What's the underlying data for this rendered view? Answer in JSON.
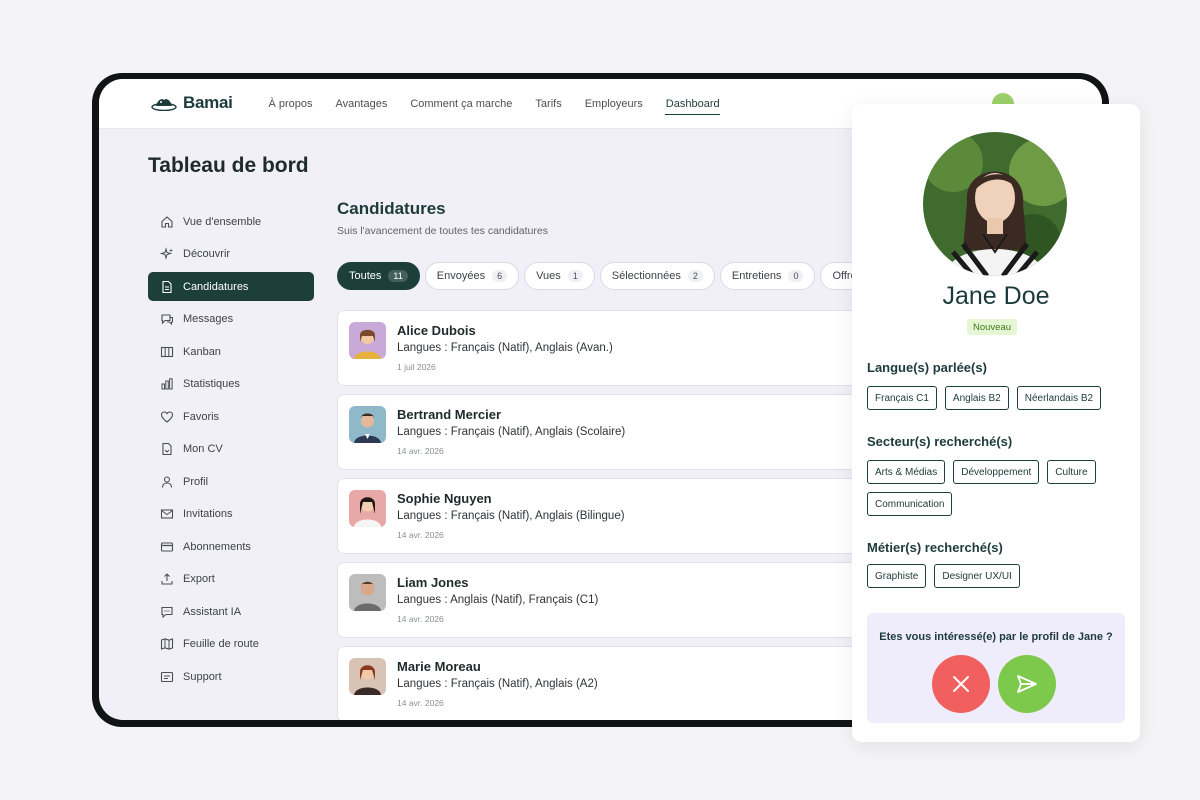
{
  "brand": {
    "name": "Bamai"
  },
  "nav": [
    {
      "label": "À propos"
    },
    {
      "label": "Avantages"
    },
    {
      "label": "Comment ça marche"
    },
    {
      "label": "Tarifs"
    },
    {
      "label": "Employeurs"
    },
    {
      "label": "Dashboard",
      "active": true
    }
  ],
  "page": {
    "title": "Tableau de bord"
  },
  "sidebar": {
    "items": [
      {
        "label": "Vue d'ensemble",
        "icon": "home-icon"
      },
      {
        "label": "Découvrir",
        "icon": "sparkles-icon"
      },
      {
        "label": "Candidatures",
        "icon": "document-icon",
        "active": true
      },
      {
        "label": "Messages",
        "icon": "chat-icon"
      },
      {
        "label": "Kanban",
        "icon": "columns-icon"
      },
      {
        "label": "Statistiques",
        "icon": "bar-chart-icon"
      },
      {
        "label": "Favoris",
        "icon": "heart-icon"
      },
      {
        "label": "Mon CV",
        "icon": "file-icon"
      },
      {
        "label": "Profil",
        "icon": "user-icon"
      },
      {
        "label": "Invitations",
        "icon": "mail-icon"
      },
      {
        "label": "Abonnements",
        "icon": "card-icon"
      },
      {
        "label": "Export",
        "icon": "upload-icon"
      },
      {
        "label": "Assistant IA",
        "icon": "chat-bubble-icon"
      },
      {
        "label": "Feuille de route",
        "icon": "map-icon"
      },
      {
        "label": "Support",
        "icon": "support-icon"
      }
    ]
  },
  "main": {
    "title": "Candidatures",
    "subtitle": "Suis l'avancement de toutes tes candidatures"
  },
  "tabs": [
    {
      "label": "Toutes",
      "count": "11",
      "active": true
    },
    {
      "label": "Envoyées",
      "count": "6"
    },
    {
      "label": "Vues",
      "count": "1"
    },
    {
      "label": "Sélectionnées",
      "count": "2"
    },
    {
      "label": "Entretiens",
      "count": "0"
    },
    {
      "label": "Offres",
      "count": ""
    }
  ],
  "candidates": [
    {
      "name": "Alice Dubois",
      "langs": "Langues : Français (Natif), Anglais (Avan.)",
      "date": "1 juil 2026",
      "color": "#c9a9d8"
    },
    {
      "name": "Bertrand Mercier",
      "langs": "Langues : Français (Natif), Anglais (Scolaire)",
      "date": "14 avr. 2026",
      "color": "#8fb9c9"
    },
    {
      "name": "Sophie Nguyen",
      "langs": "Langues : Français (Natif), Anglais (Bilingue)",
      "date": "14 avr. 2026",
      "color": "#e8a8a8"
    },
    {
      "name": "Liam Jones",
      "langs": "Langues : Anglais (Natif), Français (C1)",
      "date": "14 avr. 2026",
      "color": "#b8b8b8"
    },
    {
      "name": "Marie Moreau",
      "langs": "Langues : Français (Natif), Anglais (A2)",
      "date": "14 avr. 2026",
      "color": "#d9c3b5"
    }
  ],
  "profile": {
    "name": "Jane Doe",
    "badge": "Nouveau",
    "languages_title": "Langue(s) parlée(s)",
    "languages": [
      "Français C1",
      "Anglais B2",
      "Néerlandais B2"
    ],
    "sectors_title": "Secteur(s) recherché(s)",
    "sectors": [
      "Arts & Médias",
      "Développement",
      "Culture",
      "Communication"
    ],
    "jobs_title": "Métier(s) recherché(s)",
    "jobs": [
      "Graphiste",
      "Designer UX/UI"
    ],
    "question": "Etes vous intéressé(e) par le profil de Jane ?"
  },
  "colors": {
    "accent": "#1d3f3c",
    "reject": "#f25f5f",
    "accept": "#7cc94b",
    "badge_bg": "#e6f6d4"
  }
}
